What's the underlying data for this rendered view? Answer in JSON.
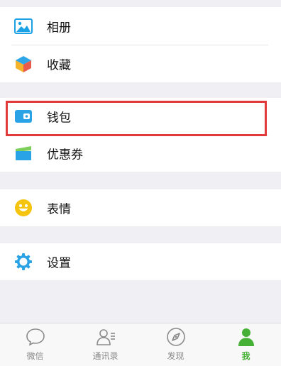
{
  "groups": [
    {
      "items": [
        {
          "label": "相册",
          "icon": "album-icon"
        },
        {
          "label": "收藏",
          "icon": "favorites-icon"
        }
      ]
    },
    {
      "items": [
        {
          "label": "钱包",
          "icon": "wallet-icon"
        },
        {
          "label": "优惠券",
          "icon": "coupon-icon"
        }
      ]
    },
    {
      "items": [
        {
          "label": "表情",
          "icon": "sticker-emoji-icon"
        }
      ]
    },
    {
      "items": [
        {
          "label": "设置",
          "icon": "settings-gear-icon"
        }
      ]
    }
  ],
  "tabbar": {
    "tabs": [
      {
        "label": "微信",
        "icon": "chat-bubble-icon",
        "active": false
      },
      {
        "label": "通讯录",
        "icon": "contacts-icon",
        "active": false
      },
      {
        "label": "发现",
        "icon": "compass-icon",
        "active": false
      },
      {
        "label": "我",
        "icon": "me-person-icon",
        "active": true
      }
    ],
    "active_color": "#45b035",
    "inactive_color": "#8a8a8a"
  },
  "highlight_color": "#e23a3a"
}
